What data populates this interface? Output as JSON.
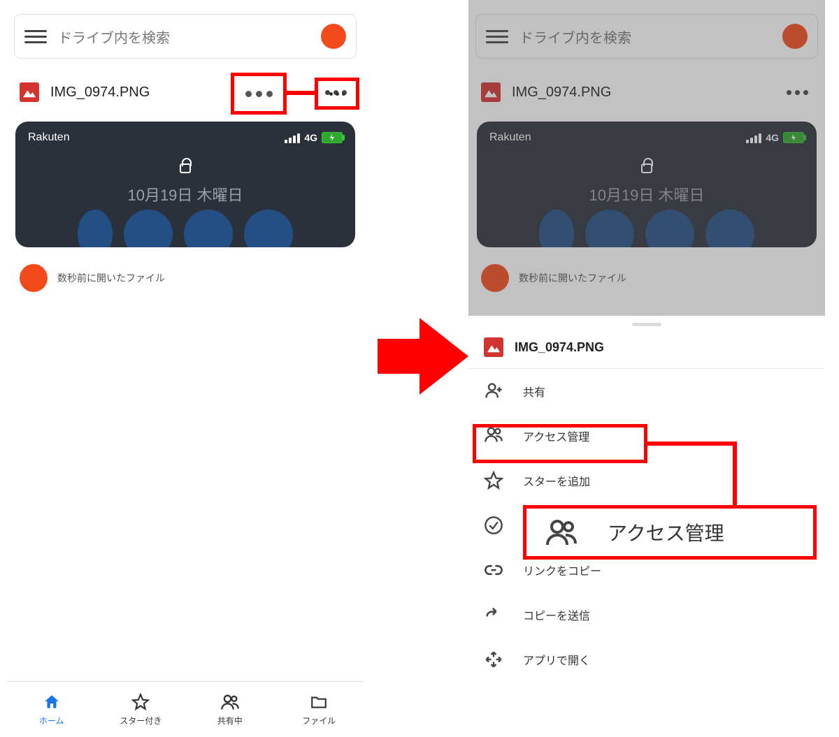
{
  "search": {
    "placeholder": "ドライブ内を検索"
  },
  "file": {
    "name": "IMG_0974.PNG"
  },
  "preview": {
    "carrier": "Rakuten",
    "network": "4G",
    "date": "10月19日 木曜日"
  },
  "recent": {
    "label": "数秒前に開いたファイル"
  },
  "nav": {
    "home": "ホーム",
    "starred": "スター付き",
    "shared": "共有中",
    "files": "ファイル"
  },
  "sheet": {
    "title": "IMG_0974.PNG",
    "items": {
      "share": "共有",
      "access": "アクセス管理",
      "star": "スターを追加",
      "offline": "",
      "copylink": "リンクをコピー",
      "sendcopy": "コピーを送信",
      "openwith": "アプリで開く"
    }
  },
  "callout": {
    "label": "アクセス管理"
  }
}
